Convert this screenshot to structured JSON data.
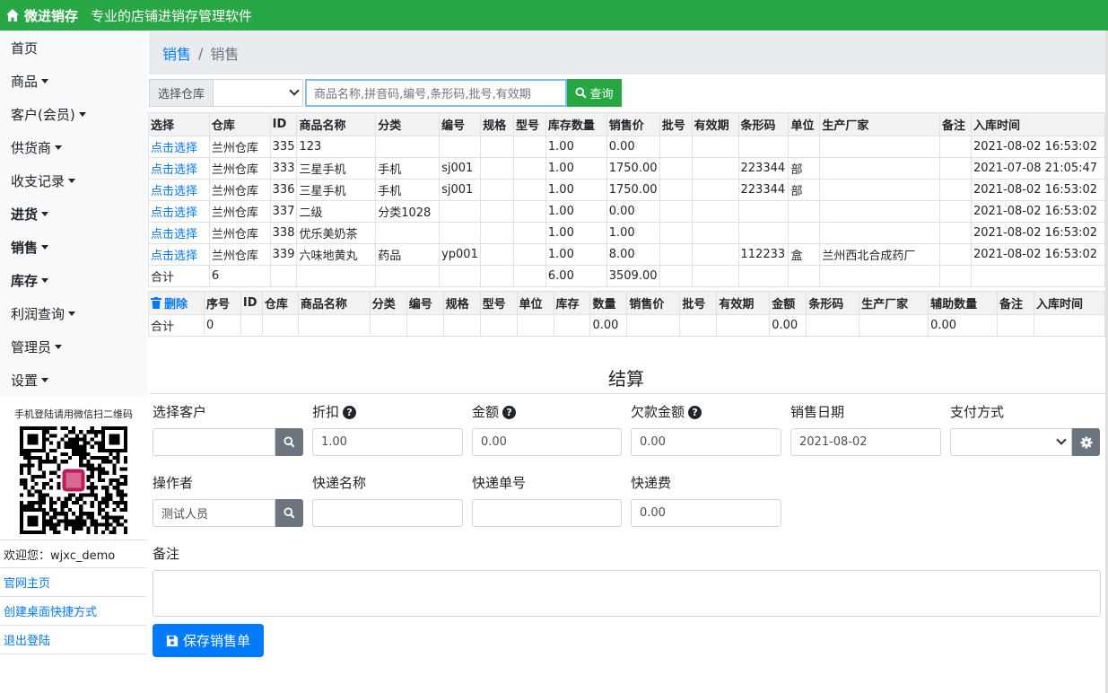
{
  "header": {
    "brand": "微进销存",
    "slogan": "专业的店铺进销存管理软件",
    "color": "#28a745"
  },
  "sidebar": {
    "items": [
      {
        "label": "首页",
        "caret": false,
        "bold": false
      },
      {
        "label": "商品",
        "caret": true,
        "bold": false
      },
      {
        "label": "客户(会员)",
        "caret": true,
        "bold": false
      },
      {
        "label": "供货商",
        "caret": true,
        "bold": false
      },
      {
        "label": "收支记录",
        "caret": true,
        "bold": false
      },
      {
        "label": "进货",
        "caret": true,
        "bold": true
      },
      {
        "label": "销售",
        "caret": true,
        "bold": true
      },
      {
        "label": "库存",
        "caret": true,
        "bold": true
      },
      {
        "label": "利润查询",
        "caret": true,
        "bold": false
      },
      {
        "label": "管理员",
        "caret": true,
        "bold": false
      },
      {
        "label": "设置",
        "caret": true,
        "bold": false
      }
    ],
    "qr_caption": "手机登陆请用微信扫二维码",
    "welcome": "欢迎您：wjxc_demo",
    "links": [
      "官网主页",
      "创建桌面快捷方式",
      "退出登陆"
    ]
  },
  "breadcrumb": {
    "parent": "销售",
    "current": "销售",
    "separator": "/"
  },
  "search": {
    "warehouse_label": "选择仓库",
    "warehouse_value": "",
    "placeholder": "商品名称,拼音码,编号,条形码,批号,有效期",
    "button": "查询"
  },
  "product_table": {
    "headers": [
      "选择",
      "仓库",
      "ID",
      "商品名称",
      "分类",
      "编号",
      "规格",
      "型号",
      "库存数量",
      "销售价",
      "批号",
      "有效期",
      "条形码",
      "单位",
      "生产厂家",
      "备注",
      "入库时间"
    ],
    "rows": [
      [
        "点击选择",
        "兰州仓库",
        "335",
        "123",
        "",
        "",
        "",
        "",
        "1.00",
        "0.00",
        "",
        "",
        "",
        "",
        "",
        "",
        "2021-08-02 16:53:02"
      ],
      [
        "点击选择",
        "兰州仓库",
        "333",
        "三星手机",
        "手机",
        "sj001",
        "",
        "",
        "1.00",
        "1750.00",
        "",
        "",
        "223344",
        "部",
        "",
        "",
        "2021-07-08 21:05:47"
      ],
      [
        "点击选择",
        "兰州仓库",
        "336",
        "三星手机",
        "手机",
        "sj001",
        "",
        "",
        "1.00",
        "1750.00",
        "",
        "",
        "223344",
        "部",
        "",
        "",
        "2021-08-02 16:53:02"
      ],
      [
        "点击选择",
        "兰州仓库",
        "337",
        "二级",
        "分类1028",
        "",
        "",
        "",
        "1.00",
        "0.00",
        "",
        "",
        "",
        "",
        "",
        "",
        "2021-08-02 16:53:02"
      ],
      [
        "点击选择",
        "兰州仓库",
        "338",
        "优乐美奶茶",
        "",
        "",
        "",
        "",
        "1.00",
        "1.00",
        "",
        "",
        "",
        "",
        "",
        "",
        "2021-08-02 16:53:02"
      ],
      [
        "点击选择",
        "兰州仓库",
        "339",
        "六味地黄丸",
        "药品",
        "yp001",
        "",
        "",
        "1.00",
        "8.00",
        "",
        "",
        "112233",
        "盒",
        "兰州西北合成药厂",
        "",
        "2021-08-02 16:53:02"
      ]
    ],
    "total": [
      "合计",
      "6",
      "",
      "",
      "",
      "",
      "",
      "",
      "6.00",
      "3509.00",
      "",
      "",
      "",
      "",
      "",
      "",
      ""
    ]
  },
  "cart_table": {
    "headers": [
      "删除",
      "序号",
      "ID",
      "仓库",
      "商品名称",
      "分类",
      "编号",
      "规格",
      "型号",
      "单位",
      "库存",
      "数量",
      "销售价",
      "批号",
      "有效期",
      "金额",
      "条形码",
      "生产厂家",
      "辅助数量",
      "备注",
      "入库时间"
    ],
    "total": [
      "合计",
      "0",
      "",
      "",
      "",
      "",
      "",
      "",
      "",
      "",
      "",
      "0.00",
      "",
      "",
      "",
      "0.00",
      "",
      "",
      "0.00",
      "",
      ""
    ]
  },
  "settlement": {
    "title": "结算",
    "customer_label": "选择客户",
    "discount_label": "折扣",
    "discount_value": "1.00",
    "amount_label": "金额",
    "amount_value": "0.00",
    "debt_label": "欠款金额",
    "debt_value": "0.00",
    "date_label": "销售日期",
    "date_value": "2021-08-02",
    "payment_label": "支付方式",
    "operator_label": "操作者",
    "operator_value": "测试人员",
    "express_name_label": "快递名称",
    "express_no_label": "快递单号",
    "express_fee_label": "快递费",
    "express_fee_value": "0.00",
    "remark_label": "备注",
    "save_button": "保存销售单",
    "help_glyph": "?"
  }
}
